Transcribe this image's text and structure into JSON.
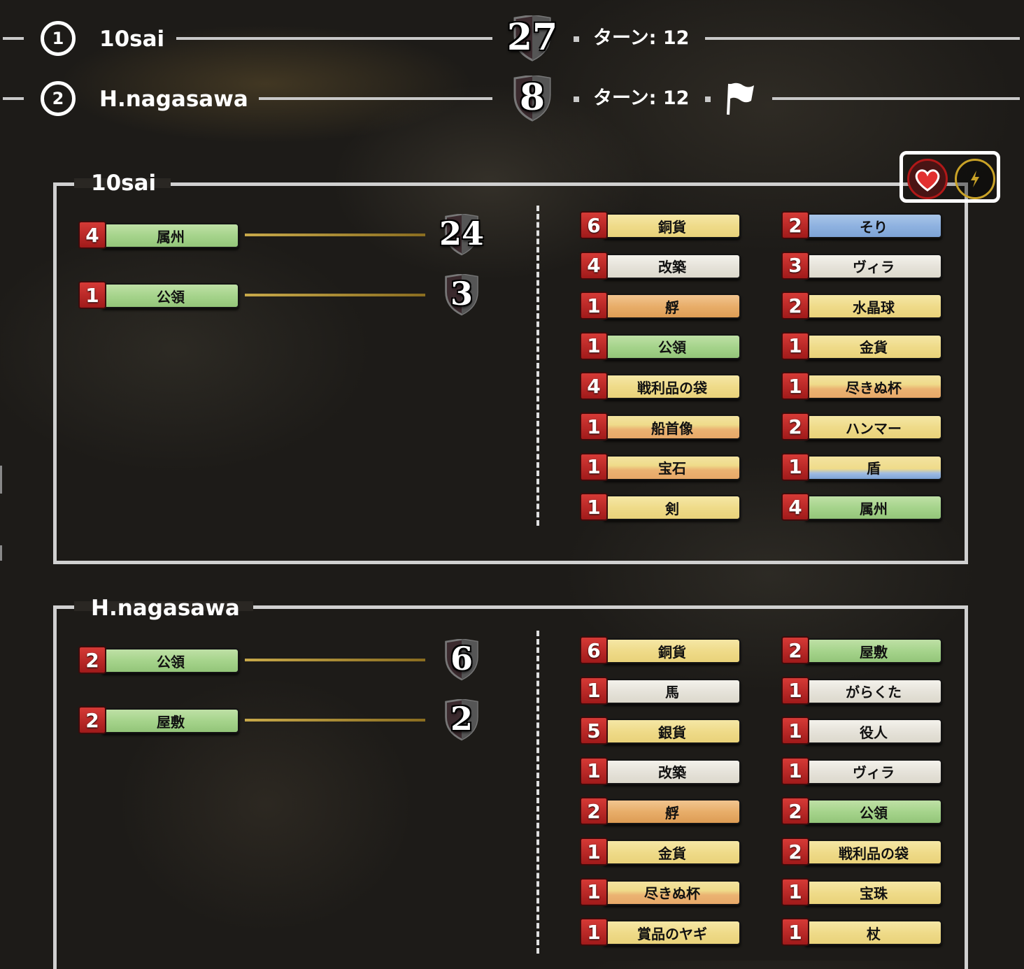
{
  "scoreboard": {
    "players": [
      {
        "rank": "1",
        "name": "10sai",
        "score": "27",
        "turn_label": "ターン: 12",
        "resigned": false
      },
      {
        "rank": "2",
        "name": "H.nagasawa",
        "score": "8",
        "turn_label": "ターン: 12",
        "resigned": true
      }
    ]
  },
  "panels": [
    {
      "name": "10sai",
      "vp_rows": [
        {
          "count": "4",
          "card": "属州",
          "type": "victory",
          "vp": "24"
        },
        {
          "count": "1",
          "card": "公領",
          "type": "victory",
          "vp": "3"
        }
      ],
      "deck_left": [
        {
          "count": "6",
          "card": "銅貨",
          "type": "treasure"
        },
        {
          "count": "4",
          "card": "改築",
          "type": "action"
        },
        {
          "count": "1",
          "card": "艀",
          "type": "night"
        },
        {
          "count": "1",
          "card": "公領",
          "type": "victory"
        },
        {
          "count": "4",
          "card": "戦利品の袋",
          "type": "treasure"
        },
        {
          "count": "1",
          "card": "船首像",
          "type": "treasure-night"
        },
        {
          "count": "1",
          "card": "宝石",
          "type": "treasure-night"
        },
        {
          "count": "1",
          "card": "剣",
          "type": "treasure"
        }
      ],
      "deck_right": [
        {
          "count": "2",
          "card": "そり",
          "type": "reaction"
        },
        {
          "count": "3",
          "card": "ヴィラ",
          "type": "action"
        },
        {
          "count": "2",
          "card": "水晶球",
          "type": "treasure"
        },
        {
          "count": "1",
          "card": "金貨",
          "type": "treasure"
        },
        {
          "count": "1",
          "card": "尽きぬ杯",
          "type": "treasure-night"
        },
        {
          "count": "2",
          "card": "ハンマー",
          "type": "treasure"
        },
        {
          "count": "1",
          "card": "盾",
          "type": "treasure-reaction"
        },
        {
          "count": "4",
          "card": "属州",
          "type": "victory"
        }
      ]
    },
    {
      "name": "H.nagasawa",
      "vp_rows": [
        {
          "count": "2",
          "card": "公領",
          "type": "victory",
          "vp": "6"
        },
        {
          "count": "2",
          "card": "屋敷",
          "type": "victory",
          "vp": "2"
        }
      ],
      "deck_left": [
        {
          "count": "6",
          "card": "銅貨",
          "type": "treasure"
        },
        {
          "count": "1",
          "card": "馬",
          "type": "action"
        },
        {
          "count": "5",
          "card": "銀貨",
          "type": "treasure"
        },
        {
          "count": "1",
          "card": "改築",
          "type": "action"
        },
        {
          "count": "2",
          "card": "艀",
          "type": "night"
        },
        {
          "count": "1",
          "card": "金貨",
          "type": "treasure"
        },
        {
          "count": "1",
          "card": "尽きぬ杯",
          "type": "treasure-night"
        },
        {
          "count": "1",
          "card": "賞品のヤギ",
          "type": "treasure"
        }
      ],
      "deck_right": [
        {
          "count": "2",
          "card": "屋敷",
          "type": "victory"
        },
        {
          "count": "1",
          "card": "がらくた",
          "type": "action"
        },
        {
          "count": "1",
          "card": "役人",
          "type": "action"
        },
        {
          "count": "1",
          "card": "ヴィラ",
          "type": "action"
        },
        {
          "count": "2",
          "card": "公領",
          "type": "victory"
        },
        {
          "count": "2",
          "card": "戦利品の袋",
          "type": "treasure"
        },
        {
          "count": "1",
          "card": "宝珠",
          "type": "treasure"
        },
        {
          "count": "1",
          "card": "杖",
          "type": "treasure"
        }
      ]
    }
  ],
  "toggles": {
    "heart_icon": "heart-icon",
    "bolt_icon": "lightning-icon",
    "heart_color": "#d42a2a",
    "bolt_color": "#c9a227"
  }
}
